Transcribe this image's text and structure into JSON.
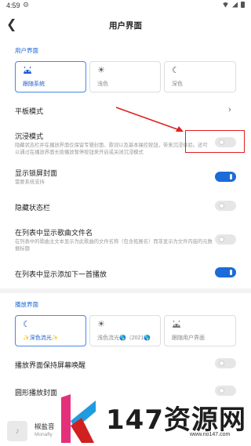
{
  "status_bar": {
    "time": "4:59",
    "gear_icon": "settings-gear-icon",
    "wifi_icon": "wifi-icon",
    "signal_icon": "signal-icon",
    "battery_icon": "battery-icon"
  },
  "app_bar": {
    "back_icon": "back-arrow-icon",
    "title": "用户界面"
  },
  "user_interface": {
    "section_title": "用户界面",
    "themes": [
      {
        "label": "跟随系统",
        "icon": "android-icon",
        "selected": true
      },
      {
        "label": "浅色",
        "icon": "sun-icon",
        "selected": false
      },
      {
        "label": "深色",
        "icon": "moon-icon",
        "selected": false
      }
    ],
    "settings": [
      {
        "title": "平板模式",
        "subtitle": "",
        "control": "chevron"
      },
      {
        "title": "沉浸模式",
        "subtitle": "隐藏状态栏并在播放界面仅保留专辑封面、歌词以及基本操控按钮，带来沉浸体验。还可以通过在播放界面长按播放暂停按钮来开启或关闭沉浸模式",
        "control": "switch",
        "on": false
      },
      {
        "title": "显示锁屏封面",
        "subtitle": "需要系统支持",
        "control": "switch",
        "on": true
      },
      {
        "title": "隐藏状态栏",
        "subtitle": "",
        "control": "switch",
        "on": false
      },
      {
        "title": "在列表中显示歌曲文件名",
        "subtitle": "在列表中的歌曲主文本显示为此歌曲的文件名称（包含拓展名）而非显示为文件内嵌的元数据标题",
        "control": "switch",
        "on": false
      },
      {
        "title": "在列表中显示添加下一首播放",
        "subtitle": "",
        "control": "switch",
        "on": true
      }
    ]
  },
  "player_interface": {
    "section_title": "播放界面",
    "styles": [
      {
        "label": "✨深色流光✨",
        "icon": "moon-icon",
        "selected": true
      },
      {
        "label": "浅色流光🌎（2021🌎",
        "icon": "sun-icon",
        "selected": false
      },
      {
        "label": "跟随用户界面",
        "icon": "android-icon",
        "selected": false
      }
    ],
    "settings": [
      {
        "title": "播放界面保持屏幕唤醒",
        "control": "switch",
        "on": false
      },
      {
        "title": "圆形播放封面",
        "control": "switch",
        "on": false
      }
    ]
  },
  "mini_player": {
    "song": "椒盐音",
    "artist": "Monafly",
    "cover_icon": "music-note-icon"
  },
  "annotation": {
    "color": "#e02020"
  },
  "watermark": {
    "text": "147资源网",
    "url": "www.no147.com"
  },
  "colors": {
    "accent": "#1b6bd8",
    "section_title": "#1a67d2"
  }
}
